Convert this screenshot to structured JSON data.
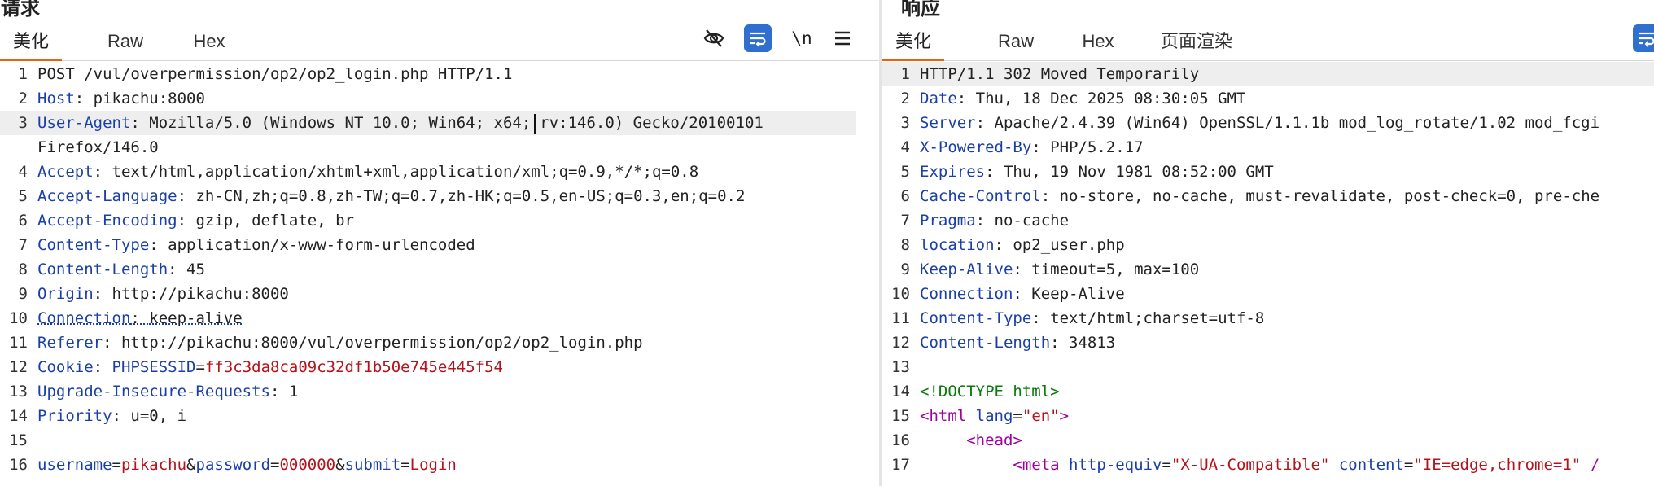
{
  "request": {
    "title": "请求",
    "tabs": [
      "美化",
      "Raw",
      "Hex"
    ],
    "icons": {
      "hide": "eye-slash-icon",
      "wrap": "wrap-lines-icon",
      "newline": "\\n",
      "menu": "hamburger-menu-icon"
    },
    "newline_label": "\\n",
    "request_line": "POST /vul/overpermission/op2/op2_login.php HTTP/1.1",
    "headers": [
      {
        "name": "Host",
        "value": "pikachu:8000"
      },
      {
        "name": "User-Agent",
        "value_a": "Mozilla/5.0 (Windows NT 10.0; Win64; x64;",
        "value_b": "rv:146.0) Gecko/20100101",
        "value_cont": "Firefox/146.0"
      },
      {
        "name": "Accept",
        "value": "text/html,application/xhtml+xml,application/xml;q=0.9,*/*;q=0.8"
      },
      {
        "name": "Accept-Language",
        "value": "zh-CN,zh;q=0.8,zh-TW;q=0.7,zh-HK;q=0.5,en-US;q=0.3,en;q=0.2"
      },
      {
        "name": "Accept-Encoding",
        "value": "gzip, deflate, br"
      },
      {
        "name": "Content-Type",
        "value": "application/x-www-form-urlencoded"
      },
      {
        "name": "Content-Length",
        "value": "45"
      },
      {
        "name": "Origin",
        "value": "http://pikachu:8000"
      },
      {
        "name": "Connection",
        "value": "keep-alive"
      },
      {
        "name": "Referer",
        "value": "http://pikachu:8000/vul/overpermission/op2/op2_login.php"
      },
      {
        "name": "Cookie",
        "cookie_key": "PHPSESSID",
        "cookie_val": "ff3c3da8ca09c32df1b50e745e445f54"
      },
      {
        "name": "Upgrade-Insecure-Requests",
        "value": "1"
      },
      {
        "name": "Priority",
        "value": "u=0, i"
      }
    ],
    "body_params": [
      {
        "key": "username",
        "value": "pikachu"
      },
      {
        "key": "password",
        "value": "000000"
      },
      {
        "key": "submit",
        "value": "Login"
      }
    ],
    "line_numbers": [
      "1",
      "2",
      "3",
      "4",
      "5",
      "6",
      "7",
      "8",
      "9",
      "10",
      "11",
      "12",
      "13",
      "14",
      "15",
      "16"
    ]
  },
  "response": {
    "title": "响应",
    "tabs": [
      "美化",
      "Raw",
      "Hex",
      "页面渲染"
    ],
    "status_line": "HTTP/1.1 302 Moved Temporarily",
    "headers": [
      {
        "name": "Date",
        "value": "Thu, 18 Dec 2025 08:30:05 GMT"
      },
      {
        "name": "Server",
        "value": "Apache/2.4.39 (Win64) OpenSSL/1.1.1b mod_log_rotate/1.02 mod_fcgi"
      },
      {
        "name": "X-Powered-By",
        "value": "PHP/5.2.17"
      },
      {
        "name": "Expires",
        "value": "Thu, 19 Nov 1981 08:52:00 GMT"
      },
      {
        "name": "Cache-Control",
        "value": "no-store, no-cache, must-revalidate, post-check=0, pre-che"
      },
      {
        "name": "Pragma",
        "value": "no-cache"
      },
      {
        "name": "location",
        "value": "op2_user.php"
      },
      {
        "name": "Keep-Alive",
        "value": "timeout=5, max=100"
      },
      {
        "name": "Connection",
        "value": "Keep-Alive"
      },
      {
        "name": "Content-Type",
        "value": "text/html;charset=utf-8"
      },
      {
        "name": "Content-Length",
        "value": "34813"
      }
    ],
    "body": {
      "doctype": "<!DOCTYPE html>",
      "html_open": "<html",
      "html_attr": "lang",
      "html_val": "\"en\"",
      "html_close": ">",
      "head": "<head>",
      "meta_open": "<meta",
      "meta_attr1": "http-equiv",
      "meta_val1": "\"X-UA-Compatible\"",
      "meta_attr2": "content",
      "meta_val2": "\"IE=edge,chrome=1\"",
      "meta_end": " /"
    },
    "line_numbers": [
      "1",
      "2",
      "3",
      "4",
      "5",
      "6",
      "7",
      "8",
      "9",
      "10",
      "11",
      "12",
      "13",
      "14",
      "15",
      "16",
      "17"
    ]
  },
  "colors": {
    "header_name": "#1a3fa8",
    "cookie_value": "#b5121b",
    "tag": "#a000a0",
    "doctype": "#0a7a0a",
    "active_tab_underline": "#e8630a",
    "wrap_button": "#2f6fd0"
  }
}
